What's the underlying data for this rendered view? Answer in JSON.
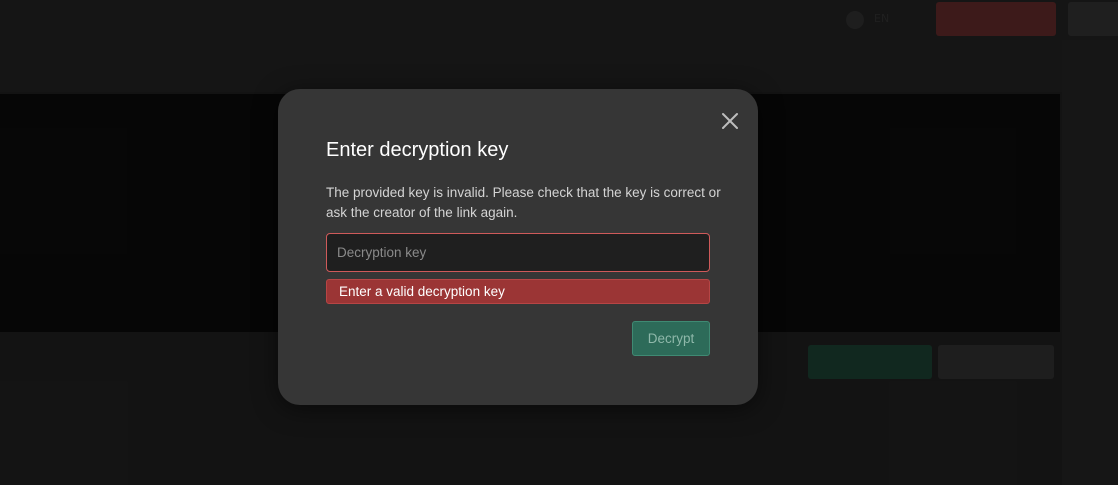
{
  "background": {
    "language_label": "EN"
  },
  "modal": {
    "title": "Enter decryption key",
    "message": "The provided key is invalid. Please check that the key is correct or ask the creator of the link again.",
    "key_input": {
      "value": "",
      "placeholder": "Decryption key"
    },
    "error_text": "Enter a valid decryption key",
    "decrypt_label": "Decrypt",
    "close_icon": "close-icon"
  },
  "colors": {
    "modal_bg": "#363636",
    "error_bg": "#9b3535",
    "input_border_error": "#cf5a5a",
    "decrypt_button_bg": "#2d6b59"
  }
}
